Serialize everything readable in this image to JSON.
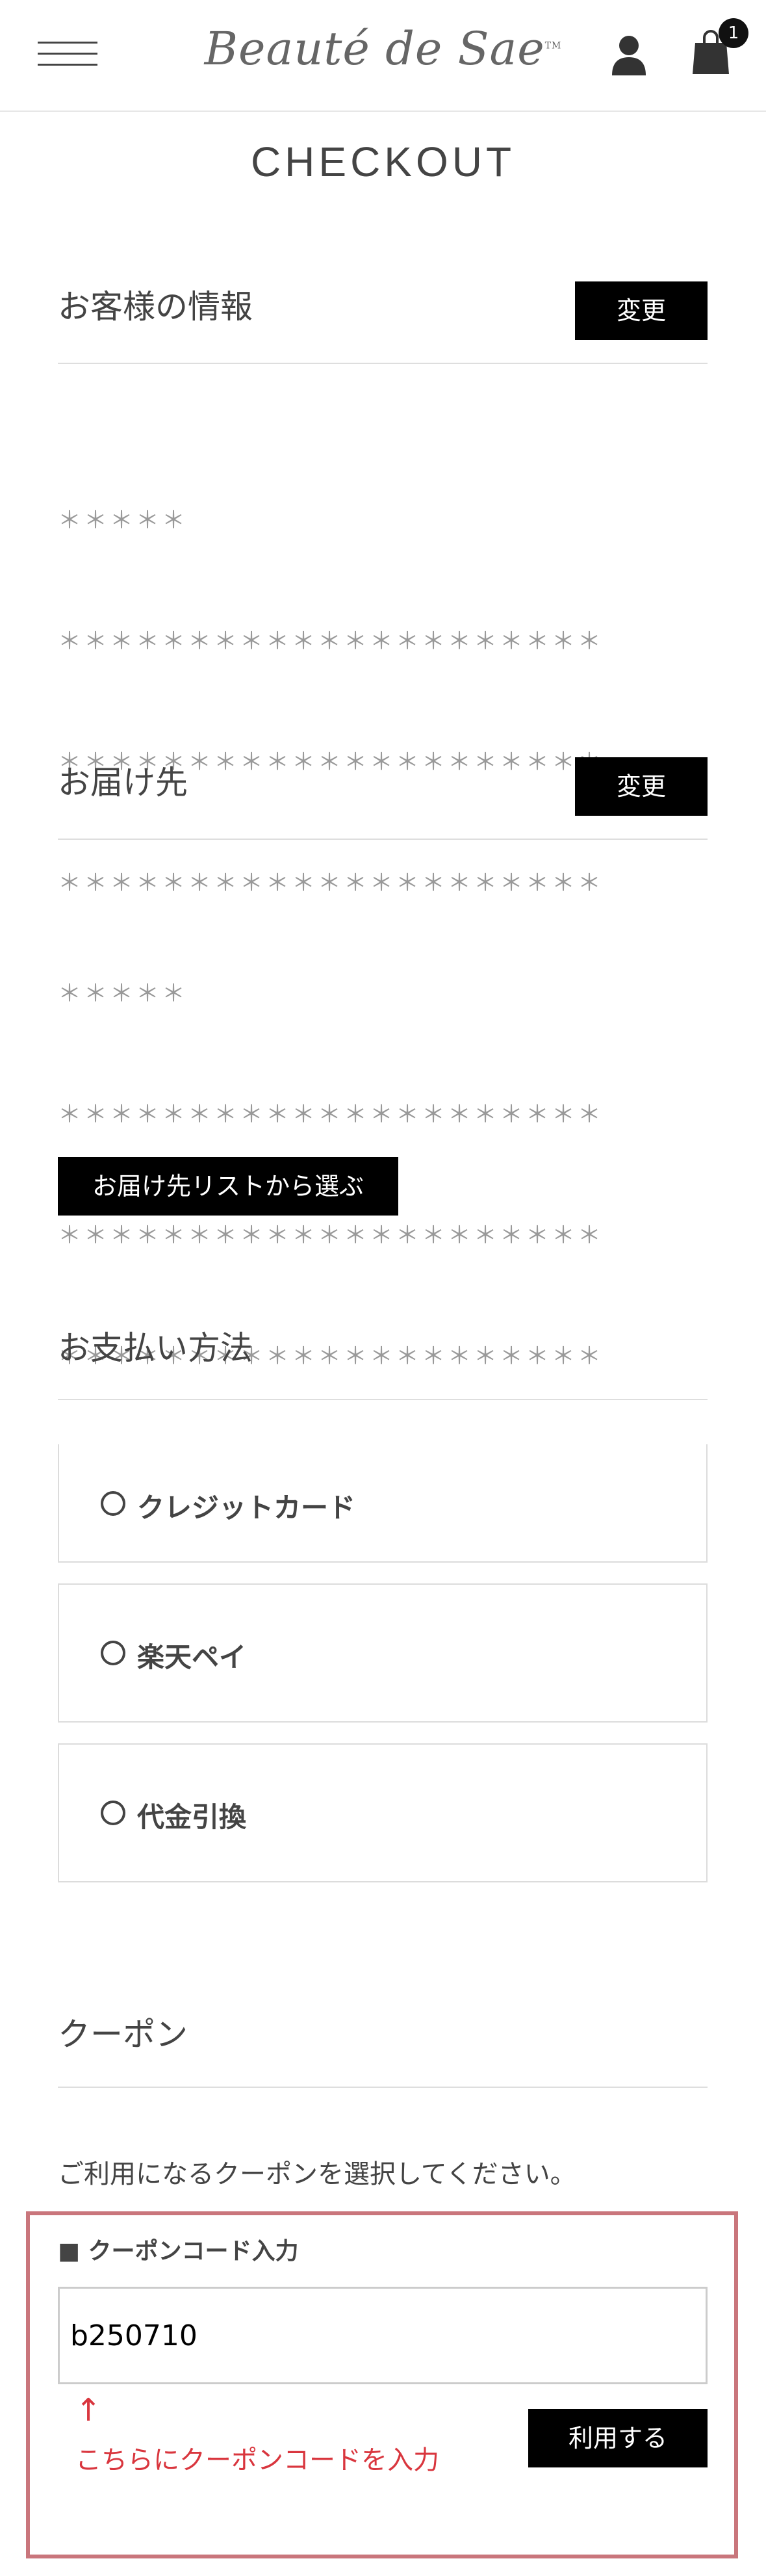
{
  "header": {
    "logo_text": "Beauté de Sae",
    "logo_tm": "TM",
    "cart_count": "1",
    "icons": {
      "menu": "hamburger-icon",
      "account": "user-icon",
      "cart": "shopping-bag-icon"
    }
  },
  "page_title": "CHECKOUT",
  "customer_info": {
    "title": "お客様の情報",
    "change_label": "変更",
    "lines": [
      "＊＊＊＊＊",
      "＊＊＊＊＊＊＊＊＊＊＊＊＊＊＊＊＊＊＊＊＊",
      "＊＊＊＊＊＊＊＊＊＊＊＊＊＊＊＊＊＊＊＊＊",
      "＊＊＊＊＊＊＊＊＊＊＊＊＊＊＊＊＊＊＊＊＊"
    ]
  },
  "shipping": {
    "title": "お届け先",
    "change_label": "変更",
    "lines": [
      "＊＊＊＊＊",
      "＊＊＊＊＊＊＊＊＊＊＊＊＊＊＊＊＊＊＊＊＊",
      "＊＊＊＊＊＊＊＊＊＊＊＊＊＊＊＊＊＊＊＊＊",
      "＊＊＊＊＊＊＊＊＊＊＊＊＊＊＊＊＊＊＊＊＊"
    ],
    "select_from_list_label": "お届け先リストから選ぶ"
  },
  "payment": {
    "title": "お支払い方法",
    "options": [
      "クレジットカード",
      "楽天ペイ",
      "代金引換"
    ]
  },
  "coupon": {
    "title": "クーポン",
    "instruction": "ご利用になるクーポンを選択してください。",
    "code_label": "■ クーポンコード入力",
    "code_value": "b250710",
    "annotation_arrow": "↑",
    "annotation_text": "こちらにクーポンコードを入力",
    "apply_label": "利用する"
  },
  "colors": {
    "accent": "#000000",
    "annotation": "#d9363e",
    "highlight_frame": "#c9767c"
  }
}
